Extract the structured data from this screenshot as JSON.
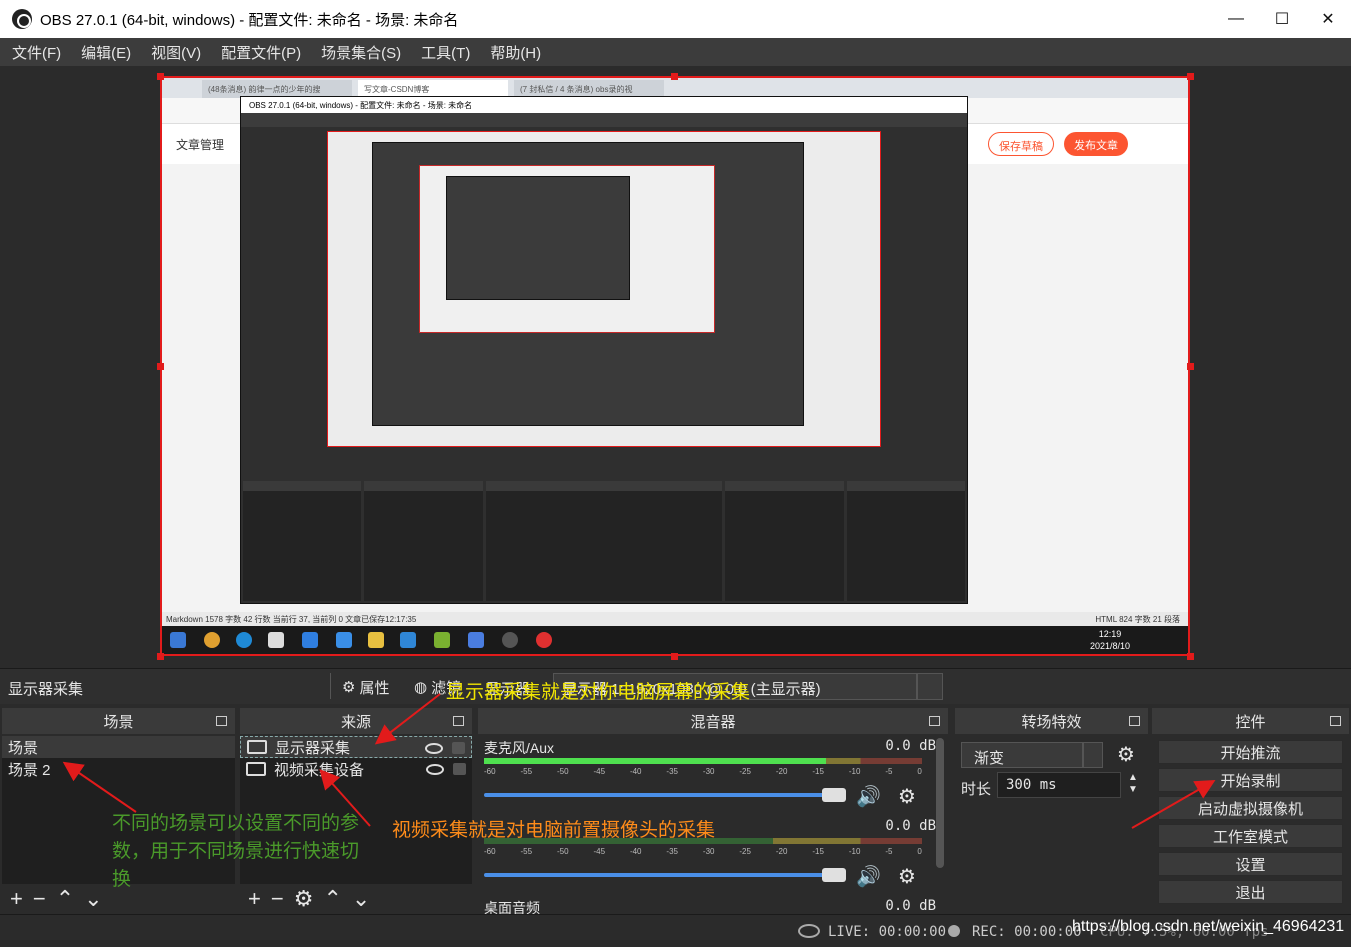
{
  "window": {
    "title": "OBS 27.0.1 (64-bit, windows) - 配置文件: 未命名 - 场景: 未命名",
    "minimize": "—",
    "maximize": "☐",
    "close": "✕"
  },
  "menu": [
    "文件(F)",
    "编辑(E)",
    "视图(V)",
    "配置文件(P)",
    "场景集合(S)",
    "工具(T)",
    "帮助(H)"
  ],
  "preview": {
    "browser_tabs": [
      "(48条消息) 韵律一点的少年的搜",
      "写文章-CSDN博客",
      "(7 封私信 / 4 条消息) obs录的视"
    ],
    "csdn_left": "文章管理",
    "csdn_save": "保存草稿",
    "csdn_publish": "发布文章",
    "status_left": "Markdown  1578 字数  42 行数  当前行 37, 当前列 0  文章已保存12:17:35",
    "status_right": "HTML  824 字数  21 段落",
    "clock_time": "12:19",
    "clock_date": "2021/8/10",
    "inner_title": "OBS 27.0.1 (64-bit, windows) - 配置文件: 未命名 - 场景: 未命名"
  },
  "source_toolbar": {
    "source_name": "显示器采集",
    "properties": "属性",
    "filters": "滤镜",
    "display_label": "显示器",
    "display_value": "显示器 1: 1920x1080 @ 0,0 (主显示器)"
  },
  "scenes": {
    "title": "场景",
    "items": [
      "场景",
      "场景 2"
    ]
  },
  "sources": {
    "title": "来源",
    "items": [
      "显示器采集",
      "视频采集设备"
    ]
  },
  "mixer": {
    "title": "混音器",
    "tracks": [
      {
        "name": "麦克风/Aux",
        "db": "0.0 dB",
        "level": 0.78
      },
      {
        "name": "",
        "db": "0.0 dB",
        "level": 0.0
      },
      {
        "name": "桌面音频",
        "db": "0.0 dB",
        "level": 0.0
      }
    ],
    "ticks": [
      "-60",
      "-55",
      "-50",
      "-45",
      "-40",
      "-35",
      "-30",
      "-25",
      "-20",
      "-15",
      "-10",
      "-5",
      "0"
    ]
  },
  "transitions": {
    "title": "转场特效",
    "selected": "渐变",
    "duration_label": "时长",
    "duration_value": "300 ms"
  },
  "controls": {
    "title": "控件",
    "buttons": [
      "开始推流",
      "开始录制",
      "启动虚拟摄像机",
      "工作室模式",
      "设置",
      "退出"
    ]
  },
  "status": {
    "live": "LIVE: 00:00:00",
    "rec": "REC: 00:00:00",
    "cpu": "CPU: 7.5%, 60.00 fps"
  },
  "annotations": {
    "display_capture": "显示器采集就是对你电脑屏幕的采集",
    "video_capture": "视频采集就是对电脑前置摄像头的采集",
    "scenes_note": "不同的场景可以设置不同的参数，用于不同场景进行快速切换"
  },
  "watermark": "https://blog.csdn.net/weixin_46964231",
  "colors": {
    "accent_red": "#e21b1b",
    "annotation_yellow": "#f2e600",
    "annotation_orange": "#ff8c1a",
    "annotation_green": "#4a9a2a"
  }
}
